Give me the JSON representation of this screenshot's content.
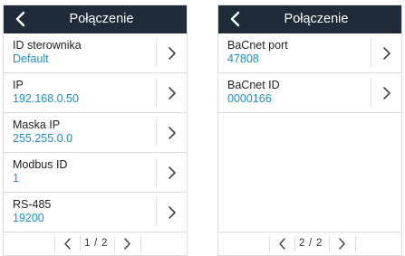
{
  "colors": {
    "header_bg": "#1f2b38",
    "value_text": "#1b8fd1",
    "divider": "#dcdcdc"
  },
  "screens": [
    {
      "title": "Połączenie",
      "items": [
        {
          "label": "ID sterownika",
          "value": "Default"
        },
        {
          "label": "IP",
          "value": "192.168.0.50"
        },
        {
          "label": "Maska IP",
          "value": "255.255.0.0"
        },
        {
          "label": "Modbus ID",
          "value": "1"
        },
        {
          "label": "RS-485",
          "value": "19200"
        }
      ],
      "pager": {
        "current": "1",
        "separator": "/",
        "total": "2"
      }
    },
    {
      "title": "Połączenie",
      "items": [
        {
          "label": "BaCnet port",
          "value": "47808"
        },
        {
          "label": "BaCnet ID",
          "value": "0000166"
        }
      ],
      "pager": {
        "current": "2",
        "separator": "/",
        "total": "2"
      }
    }
  ]
}
